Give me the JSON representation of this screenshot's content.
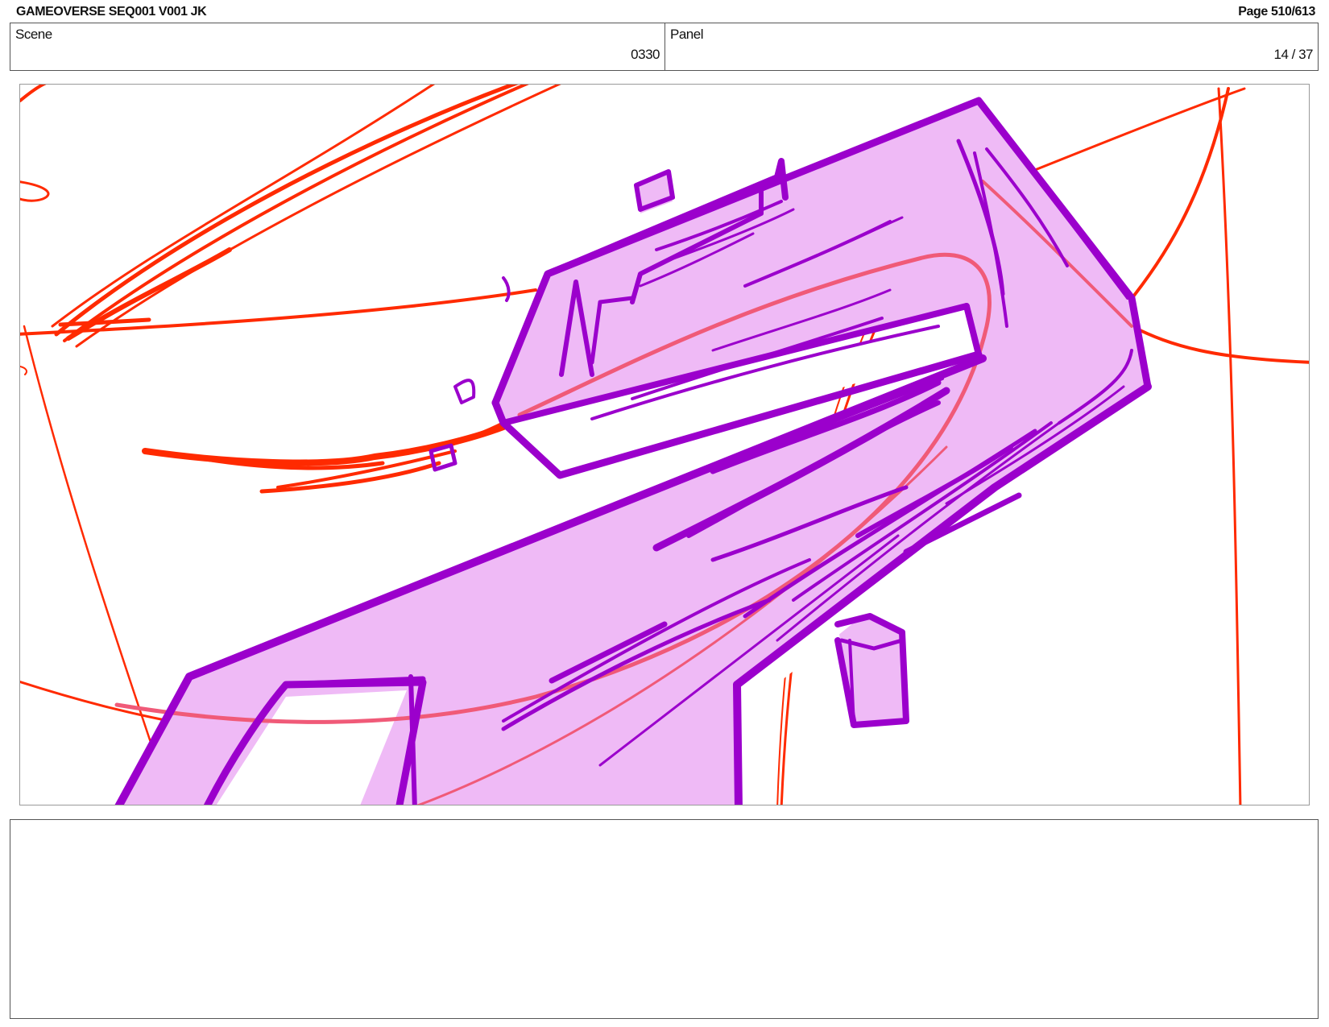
{
  "header": {
    "title": "GAMEOVERSE SEQ001 V001 JK",
    "page": "Page 510/613"
  },
  "info": {
    "scene_label": "Scene",
    "scene_value": "0330",
    "panel_label": "Panel",
    "panel_value": "14 / 37"
  },
  "drawing": {
    "description_colors": {
      "construction_lines": "#ff2a00",
      "shape_outline": "#9b00cc",
      "shape_fill": "#efbaf6",
      "inner_guide": "#f05a78"
    }
  },
  "notes": {
    "text": ""
  }
}
